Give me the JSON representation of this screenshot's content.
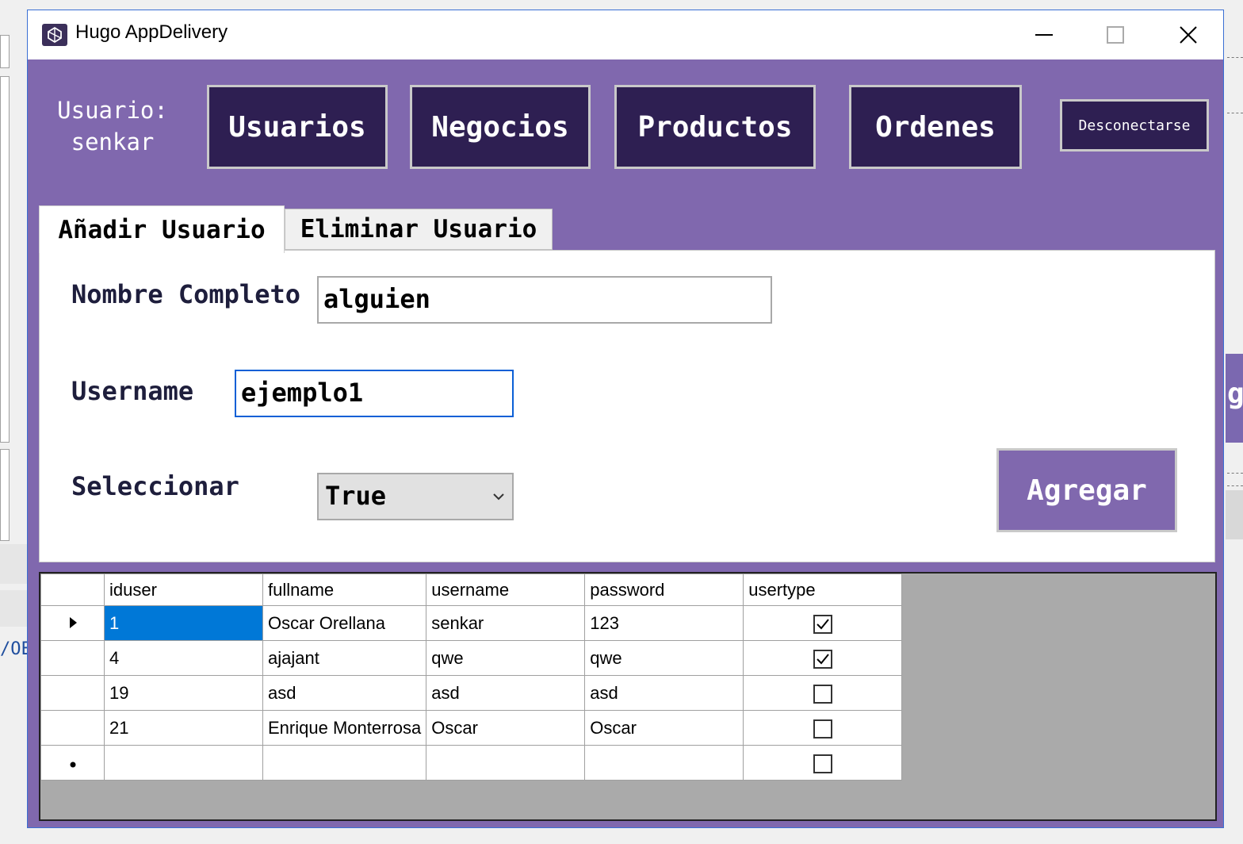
{
  "window": {
    "title": "Hugo AppDelivery"
  },
  "header": {
    "user_label": "Usuario:",
    "user_name": "senkar",
    "nav": [
      "Usuarios",
      "Negocios",
      "Productos",
      "Ordenes"
    ],
    "logout": "Desconectarse"
  },
  "tabs": [
    {
      "label": "Añadir Usuario",
      "active": true
    },
    {
      "label": "Eliminar Usuario",
      "active": false
    }
  ],
  "form": {
    "fullname_label": "Nombre Completo",
    "fullname_value": "alguien",
    "username_label": "Username",
    "username_value": "ejemplo1",
    "select_label": "Seleccionar",
    "select_value": "True",
    "submit": "Agregar"
  },
  "grid": {
    "columns": [
      "iduser",
      "fullname",
      "username",
      "password",
      "usertype"
    ],
    "rows": [
      {
        "iduser": "1",
        "fullname": "Oscar Orellana",
        "username": "senkar",
        "password": "123",
        "usertype": true
      },
      {
        "iduser": "4",
        "fullname": "ajajant",
        "username": "qwe",
        "password": "qwe",
        "usertype": true
      },
      {
        "iduser": "19",
        "fullname": "asd",
        "username": "asd",
        "password": "asd",
        "usertype": false
      },
      {
        "iduser": "21",
        "fullname": "Enrique Monterrosa",
        "username": "Oscar",
        "password": "Oscar",
        "usertype": false
      },
      {
        "iduser": "",
        "fullname": "",
        "username": "",
        "password": "",
        "usertype": false
      }
    ]
  },
  "background": {
    "fragment_text": "/OE",
    "fragment_char": "g"
  }
}
